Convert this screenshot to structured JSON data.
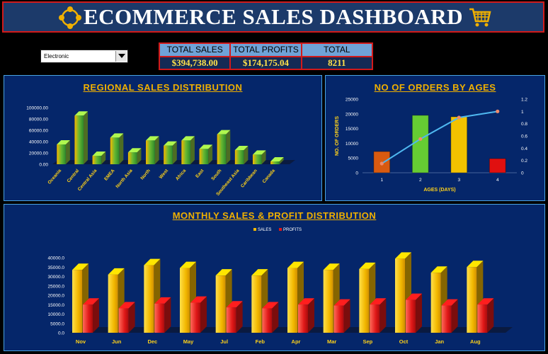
{
  "header": {
    "title": "ECOMMERCE SALES DASHBOARD"
  },
  "filter": {
    "selected": "Electronic"
  },
  "kpis": [
    {
      "label": "TOTAL SALES",
      "value": "$394,738.00"
    },
    {
      "label": "TOTAL PROFITS",
      "value": "$174,175.04"
    },
    {
      "label": "TOTAL QUANTITY",
      "value": "8211"
    }
  ],
  "colors": {
    "accent": "#f0b000",
    "panel": "#05266a",
    "border_red": "#d11a1a"
  },
  "chart_data": [
    {
      "type": "bar",
      "title": "REGIONAL SALES DISTRIBUTION",
      "categories": [
        "Oceania",
        "Central",
        "Central Asia",
        "EMEA",
        "North Asia",
        "North",
        "West",
        "Africa",
        "East",
        "South",
        "Southeast Asia",
        "Caribbean",
        "Canada"
      ],
      "values": [
        35000,
        86000,
        15000,
        47000,
        21000,
        42000,
        33000,
        42000,
        27000,
        53000,
        25000,
        17000,
        5000
      ],
      "yticks": [
        "0.00",
        "20000.00",
        "40000.00",
        "60000.00",
        "80000.00",
        "100000.00"
      ],
      "ylim": [
        0,
        100000
      ]
    },
    {
      "type": "bar",
      "title": "NO OF ORDERS BY AGES",
      "xlabel": "AGES (DAYS)",
      "ylabel": "NO. OF ORDERS",
      "categories": [
        "1",
        "2",
        "3",
        "4"
      ],
      "values": [
        7200,
        19500,
        19000,
        4800
      ],
      "bar_colors": [
        "#d85a10",
        "#66cc33",
        "#f2c200",
        "#e01010"
      ],
      "line_values": [
        0.15,
        0.55,
        0.9,
        1.0
      ],
      "yticks_left": [
        "0",
        "5000",
        "10000",
        "15000",
        "20000",
        "25000"
      ],
      "ylim_left": [
        0,
        25000
      ],
      "yticks_right": [
        "0",
        "0.2",
        "0.4",
        "0.6",
        "0.8",
        "1",
        "1.2"
      ],
      "ylim_right": [
        0,
        1.2
      ]
    },
    {
      "type": "bar",
      "title": "MONTHLY SALES & PROFIT DISTRIBUTION",
      "categories": [
        "Nov",
        "Jun",
        "Dec",
        "May",
        "Jul",
        "Feb",
        "Apr",
        "Mar",
        "Sep",
        "Oct",
        "Jan",
        "Aug"
      ],
      "series": [
        {
          "name": "SALES",
          "values": [
            335000,
            310000,
            360000,
            345000,
            305000,
            305000,
            345000,
            335000,
            340000,
            395000,
            320000,
            350000
          ],
          "color": "#f2b800"
        },
        {
          "name": "PROFITS",
          "values": [
            150000,
            130000,
            155000,
            160000,
            135000,
            130000,
            150000,
            145000,
            150000,
            175000,
            145000,
            150000
          ],
          "color": "#e01818"
        }
      ],
      "yticks": [
        "0.0",
        "5000.0",
        "10000.0",
        "15000.0",
        "20000.0",
        "25000.0",
        "30000.0",
        "35000.0",
        "40000.0"
      ],
      "ylim": [
        0,
        400000
      ]
    }
  ]
}
